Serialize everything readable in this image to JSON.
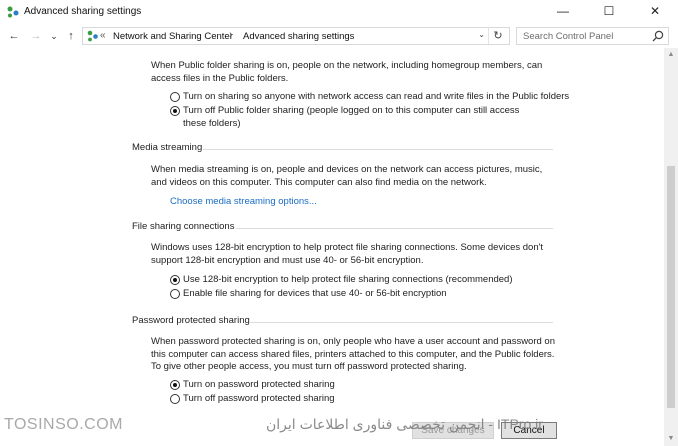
{
  "window": {
    "title": "Advanced sharing settings",
    "controls": {
      "minimize": "—",
      "maximize": "☐",
      "close": "✕"
    }
  },
  "nav": {
    "back": "←",
    "forward": "→",
    "dropdown": "⌄",
    "up": "↑"
  },
  "address": {
    "overflow": "«",
    "crumbs": [
      "Network and Sharing Center",
      "Advanced sharing settings"
    ],
    "separator": "›",
    "dropdown": "⌄",
    "refresh": "↻"
  },
  "search": {
    "placeholder": "Search Control Panel"
  },
  "public_folder": {
    "description": "When Public folder sharing is on, people on the network, including homegroup members, can access files in the Public folders.",
    "options": [
      {
        "label": "Turn on sharing so anyone with network access can read and write files in the Public folders",
        "selected": false
      },
      {
        "label": "Turn off Public folder sharing (people logged on to this computer can still access these folders)",
        "selected": true
      }
    ]
  },
  "media_streaming": {
    "heading": "Media streaming",
    "description": "When media streaming is on, people and devices on the network can access pictures, music, and videos on this computer. This computer can also find media on the network.",
    "link": "Choose media streaming options..."
  },
  "file_sharing": {
    "heading": "File sharing connections",
    "description": "Windows uses 128-bit encryption to help protect file sharing connections. Some devices don't support 128-bit encryption and must use 40- or 56-bit encryption.",
    "options": [
      {
        "label": "Use 128-bit encryption to help protect file sharing connections (recommended)",
        "selected": true
      },
      {
        "label": "Enable file sharing for devices that use 40- or 56-bit encryption",
        "selected": false
      }
    ]
  },
  "password": {
    "heading": "Password protected sharing",
    "description": "When password protected sharing is on, only people who have a user account and password on this computer can access shared files, printers attached to this computer, and the Public folders. To give other people access, you must turn off password protected sharing.",
    "options": [
      {
        "label": "Turn on password protected sharing",
        "selected": true
      },
      {
        "label": "Turn off password protected sharing",
        "selected": false
      }
    ]
  },
  "buttons": {
    "save": "Save changes",
    "cancel": "Cancel"
  },
  "watermarks": {
    "left": "TOSINSO.COM",
    "right": "ITPro.ir - انجمن تخصصی فناوری اطلاعات ایران"
  },
  "colors": {
    "link": "#1a6dc4",
    "accent": "#0078d7"
  }
}
